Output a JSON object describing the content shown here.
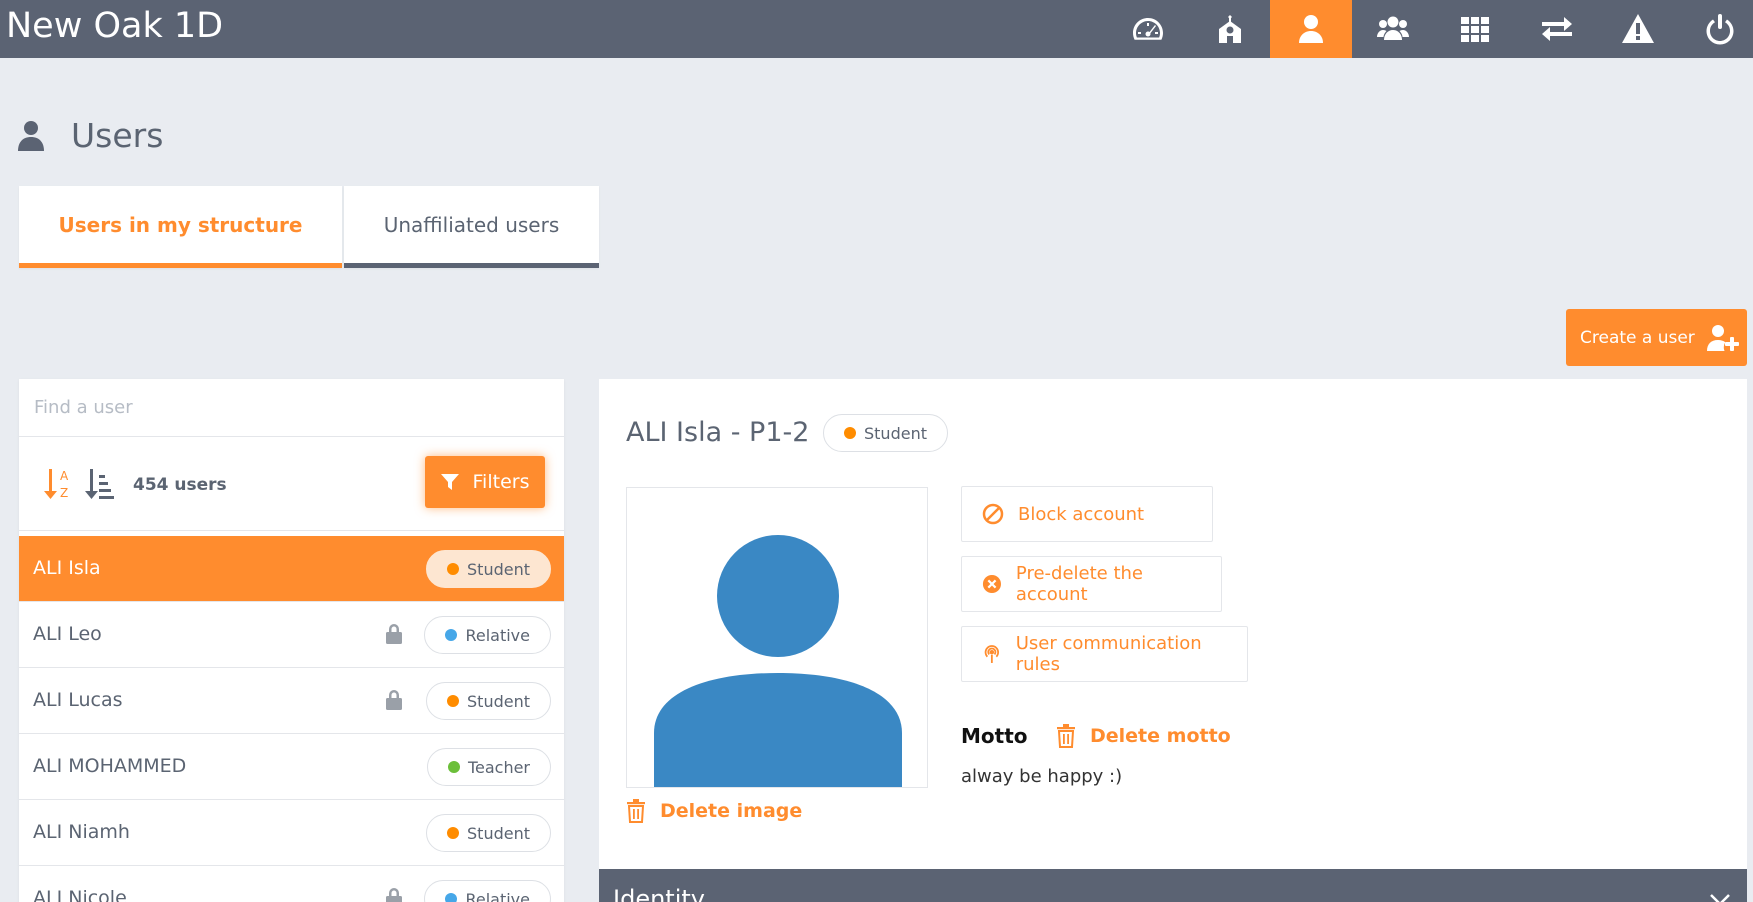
{
  "app": {
    "title": "New Oak 1D"
  },
  "nav": {
    "items": [
      {
        "icon": "dashboard-icon"
      },
      {
        "icon": "school-icon"
      },
      {
        "icon": "user-icon",
        "active": true
      },
      {
        "icon": "groups-icon"
      },
      {
        "icon": "apps-grid-icon"
      },
      {
        "icon": "transfer-icon"
      },
      {
        "icon": "warning-icon"
      },
      {
        "icon": "power-icon"
      }
    ]
  },
  "page": {
    "title": "Users"
  },
  "tabs": [
    {
      "label": "Users in my structure",
      "active": true
    },
    {
      "label": "Unaffiliated users",
      "active": false
    }
  ],
  "create_button": {
    "label": "Create a user"
  },
  "list": {
    "search_placeholder": "Find a user",
    "count_label": "454 users",
    "filters_label": "Filters",
    "users": [
      {
        "name": "ALI Isla",
        "role": "Student",
        "role_color": "#ff8c00",
        "locked": false,
        "selected": true
      },
      {
        "name": "ALI Leo",
        "role": "Relative",
        "role_color": "#46a7e8",
        "locked": true,
        "selected": false
      },
      {
        "name": "ALI Lucas",
        "role": "Student",
        "role_color": "#ff8c00",
        "locked": true,
        "selected": false
      },
      {
        "name": "ALI MOHAMMED",
        "role": "Teacher",
        "role_color": "#6cbf3a",
        "locked": false,
        "selected": false
      },
      {
        "name": "ALI Niamh",
        "role": "Student",
        "role_color": "#ff8c00",
        "locked": false,
        "selected": false
      },
      {
        "name": "ALI Nicole",
        "role": "Relative",
        "role_color": "#46a7e8",
        "locked": true,
        "selected": false
      }
    ]
  },
  "detail": {
    "title": "ALI Isla - P1-2",
    "role": "Student",
    "role_color": "#ff8c00",
    "delete_image_label": "Delete image",
    "actions": {
      "block": "Block account",
      "predelete": "Pre-delete the account",
      "communication": "User communication rules"
    },
    "motto_label": "Motto",
    "delete_motto_label": "Delete motto",
    "motto_text": "alway be happy :)",
    "identity_label": "Identity"
  },
  "colors": {
    "accent": "#ff8c2e",
    "topbar": "#5b6373",
    "avatar": "#3a88c4"
  }
}
